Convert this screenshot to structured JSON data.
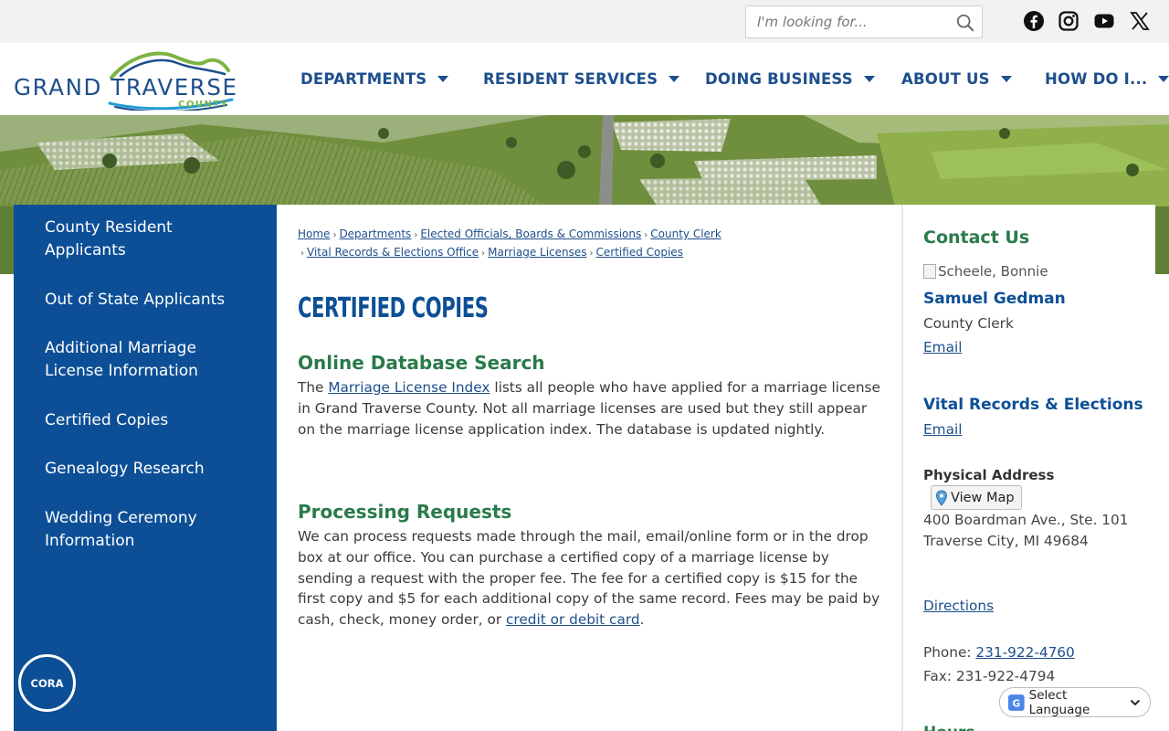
{
  "search": {
    "placeholder": "I'm looking for..."
  },
  "social": {
    "facebook_icon": "facebook-icon",
    "instagram_icon": "instagram-icon",
    "youtube_icon": "youtube-icon",
    "x_icon": "x-icon"
  },
  "logo": {
    "line1": "GRAND TRAVERSE",
    "line2": "COUNTY"
  },
  "nav": {
    "items": [
      {
        "label": "DEPARTMENTS"
      },
      {
        "label": "RESIDENT SERVICES"
      },
      {
        "label": "DOING BUSINESS"
      },
      {
        "label": "ABOUT US"
      },
      {
        "label": "HOW DO I..."
      }
    ]
  },
  "sidebar": {
    "items": [
      {
        "label": "County Resident Applicants"
      },
      {
        "label": "Out of State Applicants"
      },
      {
        "label": "Additional Marriage License Information"
      },
      {
        "label": "Certified Copies"
      },
      {
        "label": "Genealogy Research"
      },
      {
        "label": "Wedding Ceremony Information"
      }
    ],
    "cora_label": "CORA"
  },
  "breadcrumb": {
    "items": [
      "Home",
      "Departments",
      "Elected Officials, Boards & Commissions",
      "County Clerk",
      "Vital Records & Elections Office",
      "Marriage Licenses",
      "Certified Copies"
    ],
    "separator": "›"
  },
  "main": {
    "title": "CERTIFIED COPIES",
    "section1": {
      "heading": "Online Database Search",
      "prefix": "The ",
      "link": "Marriage License Index",
      "text": " lists all people who have applied for a marriage license in Grand Traverse County. Not all marriage licenses are used but they still appear on the marriage license application index. The database is updated nightly."
    },
    "section2": {
      "heading": "Processing Requests",
      "text": "We can process requests made through the mail, email/online form or in the drop box at our office.  You can purchase a certified copy of a marriage license by sending a request with the proper fee.  The fee for a certified copy is $15 for the first copy and $5 for each additional copy of the same record.  Fees may be paid by cash, check, money order, or ",
      "link": "credit or debit card",
      "suffix": "."
    }
  },
  "contact": {
    "heading": "Contact Us",
    "image_alt": "Scheele, Bonnie",
    "person_name": "Samuel Gedman",
    "person_title": "County Clerk",
    "email_label": "Email",
    "dept_name": "Vital Records & Elections",
    "dept_email_label": "Email",
    "address_heading": "Physical Address",
    "view_map_label": "View Map",
    "address_line1": "400 Boardman Ave., Ste. 101",
    "address_line2": "Traverse City, MI 49684",
    "directions_label": "Directions",
    "phone_label": "Phone: ",
    "phone": "231-922-4760",
    "fax": "Fax: 231-922-4794",
    "next_heading": "Hours"
  },
  "translate": {
    "label": "Select Language"
  },
  "colors": {
    "brand_blue": "#0d4f96",
    "nav_blue": "#1e4f8c",
    "heading_green": "#2a7a4a"
  }
}
